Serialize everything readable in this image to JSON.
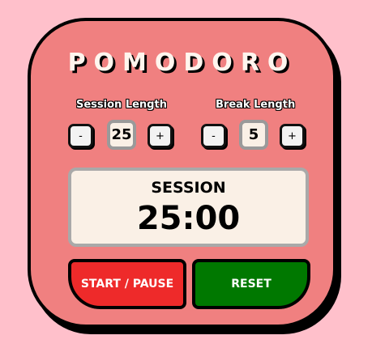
{
  "app": {
    "title": "POMODORO"
  },
  "settings": {
    "session": {
      "label": "Session Length",
      "value": "25",
      "decrement": "-",
      "increment": "+"
    },
    "break": {
      "label": "Break Length",
      "value": "5",
      "decrement": "-",
      "increment": "+"
    }
  },
  "timer": {
    "mode": "SESSION",
    "time": "25:00"
  },
  "controls": {
    "start_pause": "START / PAUSE",
    "reset": "RESET"
  },
  "colors": {
    "background": "#ffc0cb",
    "card": "#f08080",
    "start_button": "#ee2a2a",
    "reset_button": "#007800",
    "display": "#faf0e6"
  }
}
